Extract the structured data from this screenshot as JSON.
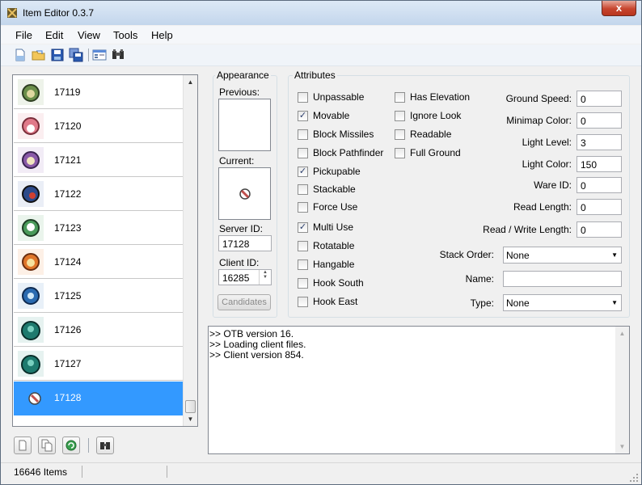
{
  "window": {
    "title": "Item Editor 0.3.7",
    "close_glyph": "x"
  },
  "menu": [
    "File",
    "Edit",
    "View",
    "Tools",
    "Help"
  ],
  "toolbar": [
    "new-file-icon",
    "open-folder-icon",
    "save-icon",
    "save-as-icon",
    "preferences-icon",
    "find-item-icon"
  ],
  "items": [
    {
      "id": "17119",
      "color": "#6b8f4a"
    },
    {
      "id": "17120",
      "color": "#e07a8a"
    },
    {
      "id": "17121",
      "color": "#8a5aa8"
    },
    {
      "id": "17122",
      "color": "#2c4a8a"
    },
    {
      "id": "17123",
      "color": "#4a9a5a"
    },
    {
      "id": "17124",
      "color": "#e0762a"
    },
    {
      "id": "17125",
      "color": "#2a6ab0"
    },
    {
      "id": "17126",
      "color": "#1e7a6e"
    },
    {
      "id": "17127",
      "color": "#1e7a6e"
    },
    {
      "id": "17128",
      "color": "#c0504d"
    }
  ],
  "selected_item": "17128",
  "appearance": {
    "title": "Appearance",
    "previous_label": "Previous:",
    "current_label": "Current:",
    "server_id_label": "Server ID:",
    "server_id": "17128",
    "client_id_label": "Client ID:",
    "client_id": "16285",
    "candidates_label": "Candidates"
  },
  "attributes": {
    "title": "Attributes",
    "col1": [
      {
        "label": "Unpassable",
        "checked": false
      },
      {
        "label": "Movable",
        "checked": true
      },
      {
        "label": "Block Missiles",
        "checked": false
      },
      {
        "label": "Block Pathfinder",
        "checked": false
      },
      {
        "label": "Pickupable",
        "checked": true
      },
      {
        "label": "Stackable",
        "checked": false
      },
      {
        "label": "Force Use",
        "checked": false
      },
      {
        "label": "Multi Use",
        "checked": true
      },
      {
        "label": "Rotatable",
        "checked": false
      },
      {
        "label": "Hangable",
        "checked": false
      },
      {
        "label": "Hook South",
        "checked": false
      },
      {
        "label": "Hook East",
        "checked": false
      }
    ],
    "col2": [
      {
        "label": "Has Elevation",
        "checked": false
      },
      {
        "label": "Ignore Look",
        "checked": false
      },
      {
        "label": "Readable",
        "checked": false
      },
      {
        "label": "Full Ground",
        "checked": false
      }
    ],
    "fields": [
      {
        "label": "Ground Speed:",
        "value": "0"
      },
      {
        "label": "Minimap Color:",
        "value": "0"
      },
      {
        "label": "Light Level:",
        "value": "3"
      },
      {
        "label": "Light Color:",
        "value": "150"
      },
      {
        "label": "Ware ID:",
        "value": "0"
      },
      {
        "label": "Read Length:",
        "value": "0"
      },
      {
        "label": "Read / Write Length:",
        "value": "0"
      }
    ],
    "stack_order_label": "Stack Order:",
    "stack_order": "None",
    "name_label": "Name:",
    "name": "",
    "type_label": "Type:",
    "type": "None"
  },
  "log": [
    ">> OTB version 16.",
    ">> Loading client files.",
    ">> Client version 854."
  ],
  "status": {
    "items_count": "16646 Items"
  }
}
